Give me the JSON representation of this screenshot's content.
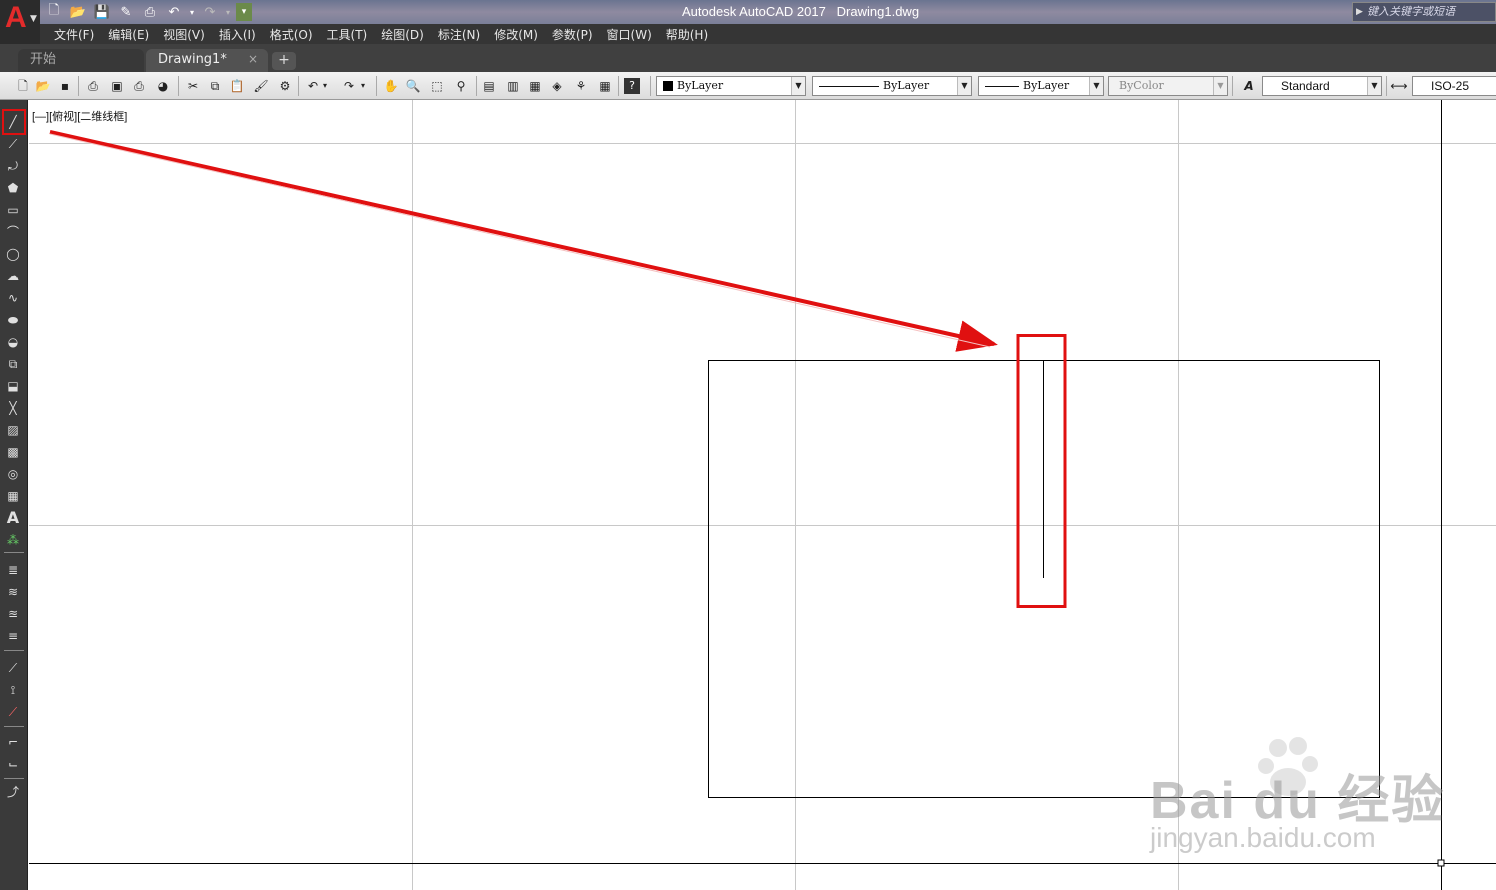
{
  "titlebar": {
    "logo_letter": "A",
    "app_name": "Autodesk AutoCAD 2017",
    "file_name": "Drawing1.dwg",
    "search_placeholder": "键入关键字或短语"
  },
  "menu": [
    "文件(F)",
    "编辑(E)",
    "视图(V)",
    "插入(I)",
    "格式(O)",
    "工具(T)",
    "绘图(D)",
    "标注(N)",
    "修改(M)",
    "参数(P)",
    "窗口(W)",
    "帮助(H)"
  ],
  "tabs": {
    "start": "开始",
    "drawing": "Drawing1*",
    "close_glyph": "×",
    "add_glyph": "+"
  },
  "properties": {
    "color": "ByLayer",
    "linetype": "ByLayer",
    "lineweight": "ByLayer",
    "plotstyle": "ByColor",
    "text_style": "Standard",
    "dim_style": "ISO-25"
  },
  "viewport": {
    "label": "[—][俯视][二维线框]"
  },
  "left_toolbar": {
    "text_tool": "A"
  },
  "watermark": {
    "brand": "Bai du 经验",
    "url": "jingyan.baidu.com"
  },
  "colors": {
    "highlight": "#e01010",
    "canvas": "#ffffff",
    "grid": "#c8c8c8",
    "geometry": "#000000"
  }
}
